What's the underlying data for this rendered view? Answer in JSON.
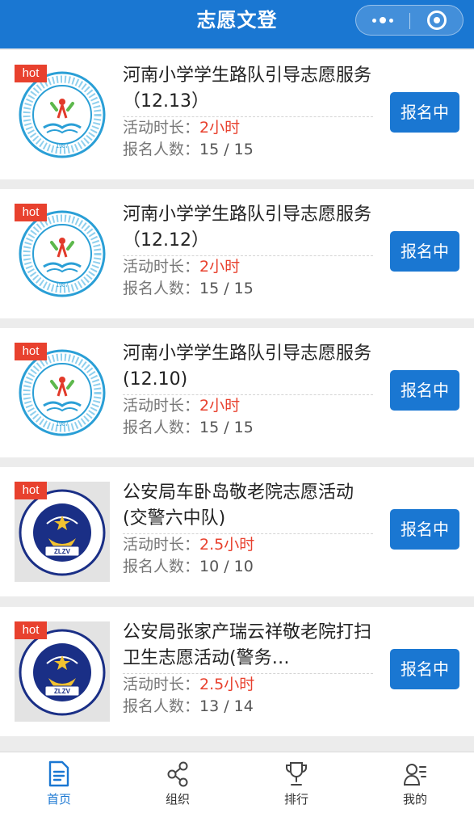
{
  "header": {
    "title": "志愿文登"
  },
  "activities": [
    {
      "badge": "hot",
      "title": "河南小学学生路队引导志愿服务（12.13）",
      "duration_label": "活动时长：",
      "duration": "2小时",
      "enroll_label": "报名人数：",
      "enrolled": "15 / 15",
      "button": "报名中",
      "logo": "school"
    },
    {
      "badge": "hot",
      "title": "河南小学学生路队引导志愿服务（12.12）",
      "duration_label": "活动时长：",
      "duration": "2小时",
      "enroll_label": "报名人数：",
      "enrolled": "15 / 15",
      "button": "报名中",
      "logo": "school"
    },
    {
      "badge": "hot",
      "title": "河南小学学生路队引导志愿服务(12.10)",
      "duration_label": "活动时长：",
      "duration": "2小时",
      "enroll_label": "报名人数：",
      "enrolled": "15 / 15",
      "button": "报名中",
      "logo": "school"
    },
    {
      "badge": "hot",
      "title": "公安局车卧岛敬老院志愿活动(交警六中队)",
      "duration_label": "活动时长：",
      "duration": "2.5小时",
      "enroll_label": "报名人数：",
      "enrolled": "10 / 10",
      "button": "报名中",
      "logo": "police"
    },
    {
      "badge": "hot",
      "title": "公安局张家产瑞云祥敬老院打扫卫生志愿活动(警务…",
      "duration_label": "活动时长：",
      "duration": "2.5小时",
      "enroll_label": "报名人数：",
      "enrolled": "13 / 14",
      "button": "报名中",
      "logo": "police"
    }
  ],
  "logos": {
    "school": {
      "year": "1987",
      "ring_text": "威海市文登区河南小学",
      "icon": "school-emblem-icon"
    },
    "police": {
      "banner": "ZLZV",
      "ring_text": "文登分局藏蓝志愿服务队",
      "icon": "police-emblem-icon"
    }
  },
  "tabs": [
    {
      "label": "首页",
      "icon": "home-doc-icon",
      "active": true
    },
    {
      "label": "组织",
      "icon": "share-icon",
      "active": false
    },
    {
      "label": "排行",
      "icon": "trophy-icon",
      "active": false
    },
    {
      "label": "我的",
      "icon": "user-list-icon",
      "active": false
    }
  ],
  "colors": {
    "brand": "#1a77d2",
    "hot": "#e8412e",
    "accent_text": "#e8412e"
  }
}
